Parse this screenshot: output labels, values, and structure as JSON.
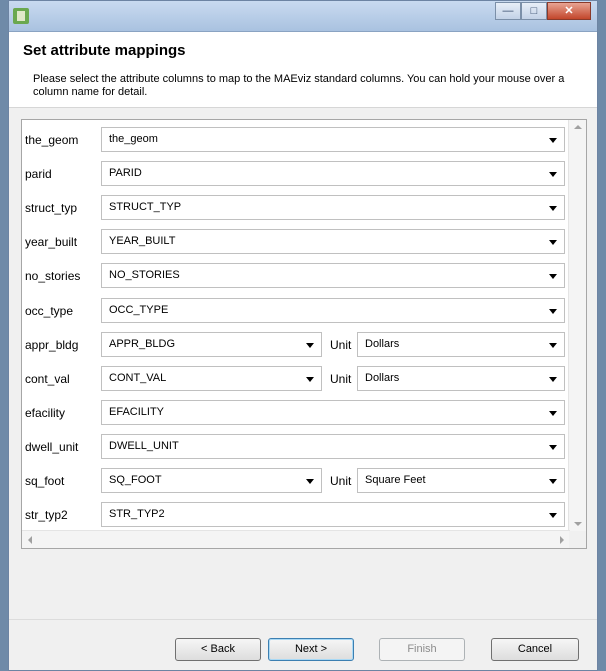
{
  "window": {
    "minimize": "—",
    "maximize": "□",
    "close": "✕"
  },
  "header": {
    "title": "Set attribute mappings",
    "description": "Please select the attribute columns to map to the MAEviz standard columns.  You can hold your mouse over a column name for detail."
  },
  "mappings": [
    {
      "label": "the_geom",
      "value": "the_geom"
    },
    {
      "label": "parid",
      "value": "PARID"
    },
    {
      "label": "struct_typ",
      "value": "STRUCT_TYP"
    },
    {
      "label": "year_built",
      "value": "YEAR_BUILT"
    },
    {
      "label": "no_stories",
      "value": "NO_STORIES"
    },
    {
      "label": "occ_type",
      "value": "OCC_TYPE"
    },
    {
      "label": "appr_bldg",
      "value": "APPR_BLDG",
      "unit_label": "Unit",
      "unit": "Dollars"
    },
    {
      "label": "cont_val",
      "value": "CONT_VAL",
      "unit_label": "Unit",
      "unit": "Dollars"
    },
    {
      "label": "efacility",
      "value": "EFACILITY"
    },
    {
      "label": "dwell_unit",
      "value": "DWELL_UNIT"
    },
    {
      "label": "sq_foot",
      "value": "SQ_FOOT",
      "unit_label": "Unit",
      "unit": "Square Feet"
    },
    {
      "label": "str_typ2",
      "value": "STR_TYP2"
    }
  ],
  "buttons": {
    "back": "< Back",
    "next": "Next >",
    "finish": "Finish",
    "cancel": "Cancel"
  }
}
